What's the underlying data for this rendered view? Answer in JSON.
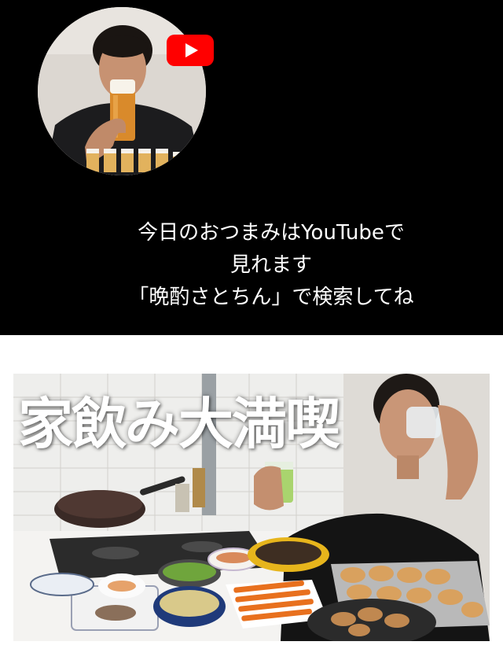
{
  "promo": {
    "caption_lines": [
      "今日のおつまみはYouTubeで",
      "見れます",
      "「晩酌さとちん」で検索してね"
    ],
    "youtube_badge_icon": "youtube-play-icon",
    "avatar_icon": "woman-drinking-beer-avatar"
  },
  "thumbnail": {
    "title": "家飲み大満喫"
  },
  "colors": {
    "top_background": "#000000",
    "caption_text": "#ffffff",
    "youtube_red": "#ff0000",
    "page_background": "#ffffff"
  }
}
